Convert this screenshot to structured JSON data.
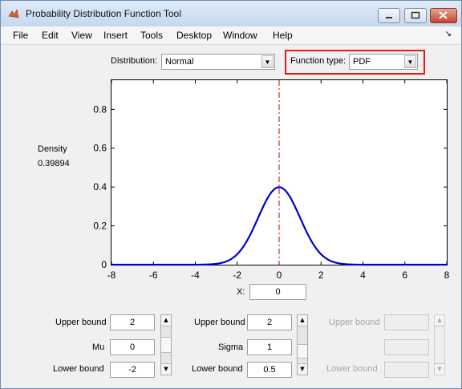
{
  "window": {
    "title": "Probability Distribution Function Tool"
  },
  "menu": [
    "File",
    "Edit",
    "View",
    "Insert",
    "Tools",
    "Desktop",
    "Window",
    "Help"
  ],
  "distribution": {
    "label": "Distribution:",
    "value": "Normal"
  },
  "function_type": {
    "label": "Function type:",
    "value": "PDF"
  },
  "density": {
    "label": "Density",
    "value": "0.39894"
  },
  "x_input": {
    "label": "X:",
    "value": "0"
  },
  "param_groups": [
    {
      "upper_label": "Upper bound",
      "upper_value": "2",
      "name_label": "Mu",
      "name_value": "0",
      "lower_label": "Lower bound",
      "lower_value": "-2",
      "slider_pos": 0.5
    },
    {
      "upper_label": "Upper bound",
      "upper_value": "2",
      "name_label": "Sigma",
      "name_value": "1",
      "lower_label": "Lower bound",
      "lower_value": "0.5",
      "slider_pos": 0.33
    },
    {
      "upper_label": "Upper bound",
      "upper_value": "",
      "name_label": "",
      "name_value": "",
      "lower_label": "Lower bound",
      "lower_value": "",
      "slider_pos": 0.5
    }
  ],
  "colors": {
    "curve": "#0000cc",
    "marker": "#cc0000",
    "highlight": "#e01b1b"
  },
  "chart_data": {
    "type": "line",
    "title": "",
    "xlabel": "",
    "ylabel": "",
    "xlim": [
      -8,
      8
    ],
    "ylim": [
      0,
      0.95
    ],
    "xticks": [
      "-8",
      "-6",
      "-4",
      "-2",
      "0",
      "2",
      "4",
      "6",
      "8"
    ],
    "yticks": [
      "0",
      "0.2",
      "0.4",
      "0.6",
      "0.8"
    ],
    "series": [
      {
        "name": "",
        "function": "normal pdf",
        "mu": 0,
        "sigma": 1
      }
    ],
    "marker_x": 0,
    "grid": false
  }
}
